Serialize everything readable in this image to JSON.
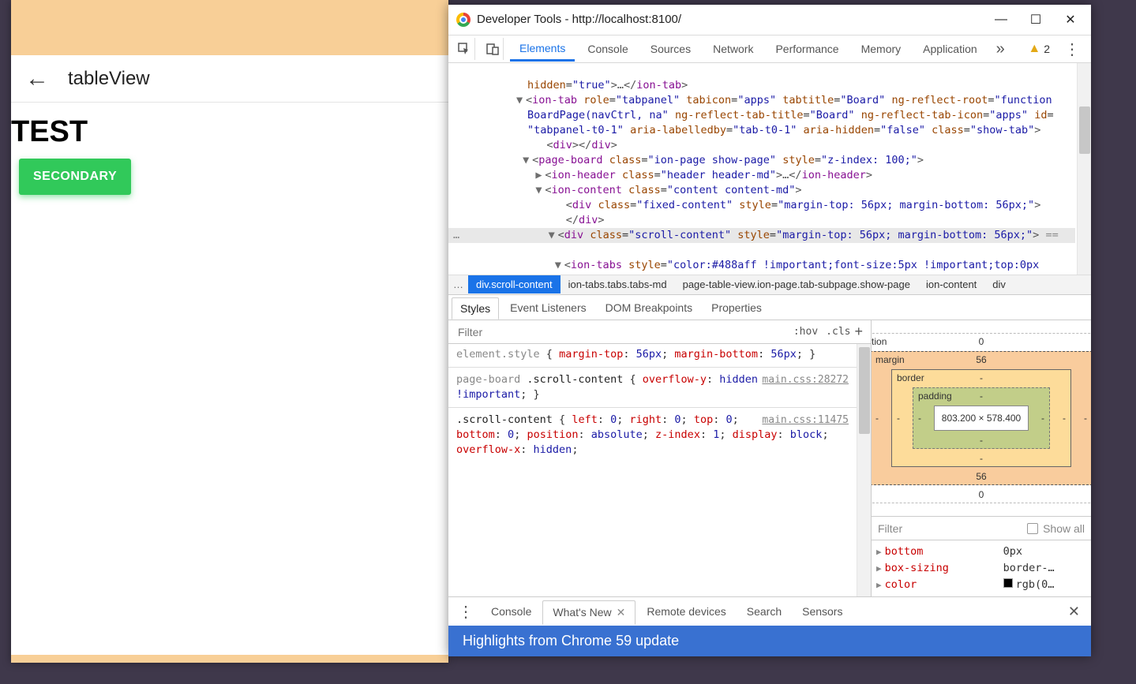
{
  "mobile": {
    "header_title": "tableView",
    "h1": "TEST",
    "button": "SECONDARY"
  },
  "window": {
    "title": "Developer Tools - http://localhost:8100/"
  },
  "tabs": {
    "elements": "Elements",
    "console": "Console",
    "sources": "Sources",
    "network": "Network",
    "performance": "Performance",
    "memory": "Memory",
    "application": "Application",
    "warn_count": "2"
  },
  "breadcrumb": {
    "ellipsis": "…",
    "sel": "div.scroll-content",
    "r1": "ion-tabs.tabs.tabs-md",
    "r2": "page-table-view.ion-page.tab-subpage.show-page",
    "r3": "ion-content",
    "r4": "div"
  },
  "styles_tabs": {
    "styles": "Styles",
    "event": "Event Listeners",
    "dom": "DOM Breakpoints",
    "props": "Properties"
  },
  "filter": {
    "placeholder": "Filter",
    "hov": ":hov",
    "cls": ".cls"
  },
  "css": {
    "src1": "main.css:28272",
    "src2": "main.css:11475"
  },
  "boxmodel": {
    "position": "position",
    "margin": "margin",
    "border": "border",
    "padding": "padding",
    "content": "803.200 × 578.400",
    "margin_top": "56",
    "margin_bottom": "56",
    "pos_zero": "0",
    "dash": "-"
  },
  "computed": {
    "filter": "Filter",
    "showall": "Show all",
    "bottom": "bottom",
    "bottom_v": "0px",
    "boxsizing": "box-sizing",
    "boxsizing_v": "border-…",
    "color": "color",
    "color_v": "rgb(0…"
  },
  "drawer": {
    "console": "Console",
    "whatsnew": "What's New",
    "remote": "Remote devices",
    "search": "Search",
    "sensors": "Sensors",
    "headline": "Highlights from Chrome 59 update"
  }
}
